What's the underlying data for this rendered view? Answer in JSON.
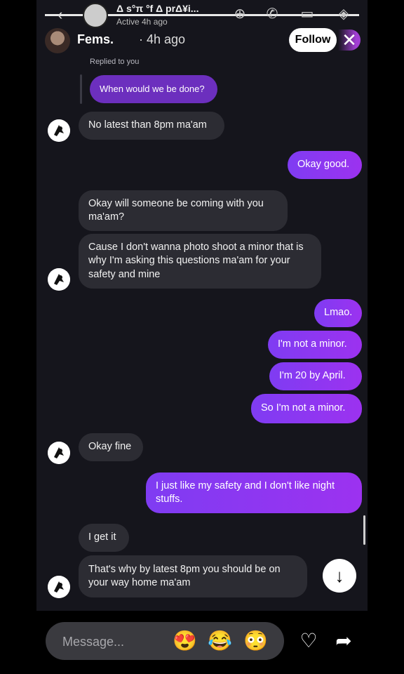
{
  "header": {
    "title": "Δ s°π °f Δ prΔ¥i...",
    "active_status": "Active 4h ago"
  },
  "story": {
    "username": "Fems.",
    "time": "· 4h ago",
    "follow_label": "Follow",
    "close_label": "✕"
  },
  "reply": {
    "label": "Replied to you",
    "quoted": "When would we be done?"
  },
  "messages": [
    "No latest than 8pm ma'am",
    "Okay good.",
    "Okay will someone be coming with you ma'am?",
    "Cause I don't wanna photo shoot a minor that is why I'm asking this questions ma'am for your safety and mine",
    "Lmao.",
    "I'm not a minor.",
    "I'm 20 by April.",
    "So I'm not a minor.",
    "Okay fine",
    "I just like my safety and I don't like night stuffs.",
    "I get it",
    "That's why by latest 8pm you should be on your way home ma'am"
  ],
  "composer": {
    "placeholder": "Message...",
    "emojis": [
      "😍",
      "😂",
      "😳"
    ]
  },
  "icons": {
    "back": "chevron-left-icon",
    "down": "arrow-down-icon",
    "like": "heart-icon",
    "share": "share-icon"
  }
}
